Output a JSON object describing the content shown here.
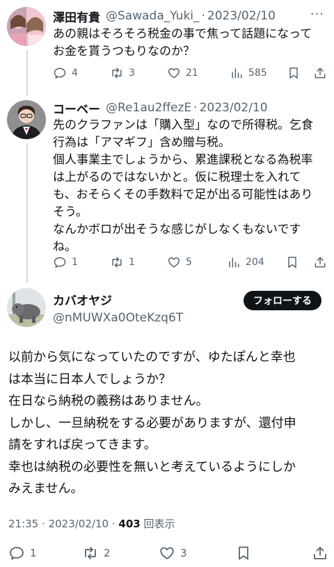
{
  "replies": [
    {
      "name": "澤田有貴",
      "handle": "@Sawada_Yuki_",
      "separator": "·",
      "date": "2023/02/10",
      "lines": [
        "あの親はそろそろ税金の事で焦って話題になって",
        "お金を貰うつもりなのか？"
      ],
      "reply_count": "4",
      "retweet_count": "3",
      "like_count": "21",
      "view_count": "585"
    },
    {
      "name": "コーベー",
      "handle": "@Re1au2ffezE",
      "separator": "·",
      "date": "2023/02/10",
      "lines": [
        "先のクラファンは「購入型」なので所得税。乞食",
        "行為は「アマギフ」含め贈与税。",
        "個人事業主でしょうから、累進課税となる為税率",
        "は上がるのではないかと。仮に税理士を入れて",
        "も、おそらくその手数料で足が出る可能性はあり",
        "そう。",
        "なんかボロが出そうな感じがしなくもないです",
        "ね。"
      ],
      "reply_count": "1",
      "retweet_count": "1",
      "like_count": "5",
      "view_count": "204"
    }
  ],
  "main": {
    "name": "カバオヤジ",
    "handle": "@nMUWXa0OteKzq6T",
    "follow_label": "フォローする",
    "lines": [
      "以前から気になっていたのですが、ゆたぽんと幸也",
      "は本当に日本人でしょうか？",
      "在日なら納税の義務はありません。",
      "しかし、一旦納税をする必要がありますが、還付申",
      "請をすれば戻ってきます。",
      "幸也は納税の必要性を無いと考えているようにしか",
      "みえません。"
    ],
    "time": "21:35",
    "separator": "·",
    "date": "2023/02/10",
    "views_number": "403",
    "views_label": "回表示",
    "reply_count": "1",
    "retweet_count": "2",
    "like_count": "3"
  },
  "more_symbol": "···",
  "colors": {
    "text": "#0f1419",
    "secondary": "#536471",
    "thread_line": "#cfd9de",
    "button_bg": "#0f1419"
  }
}
